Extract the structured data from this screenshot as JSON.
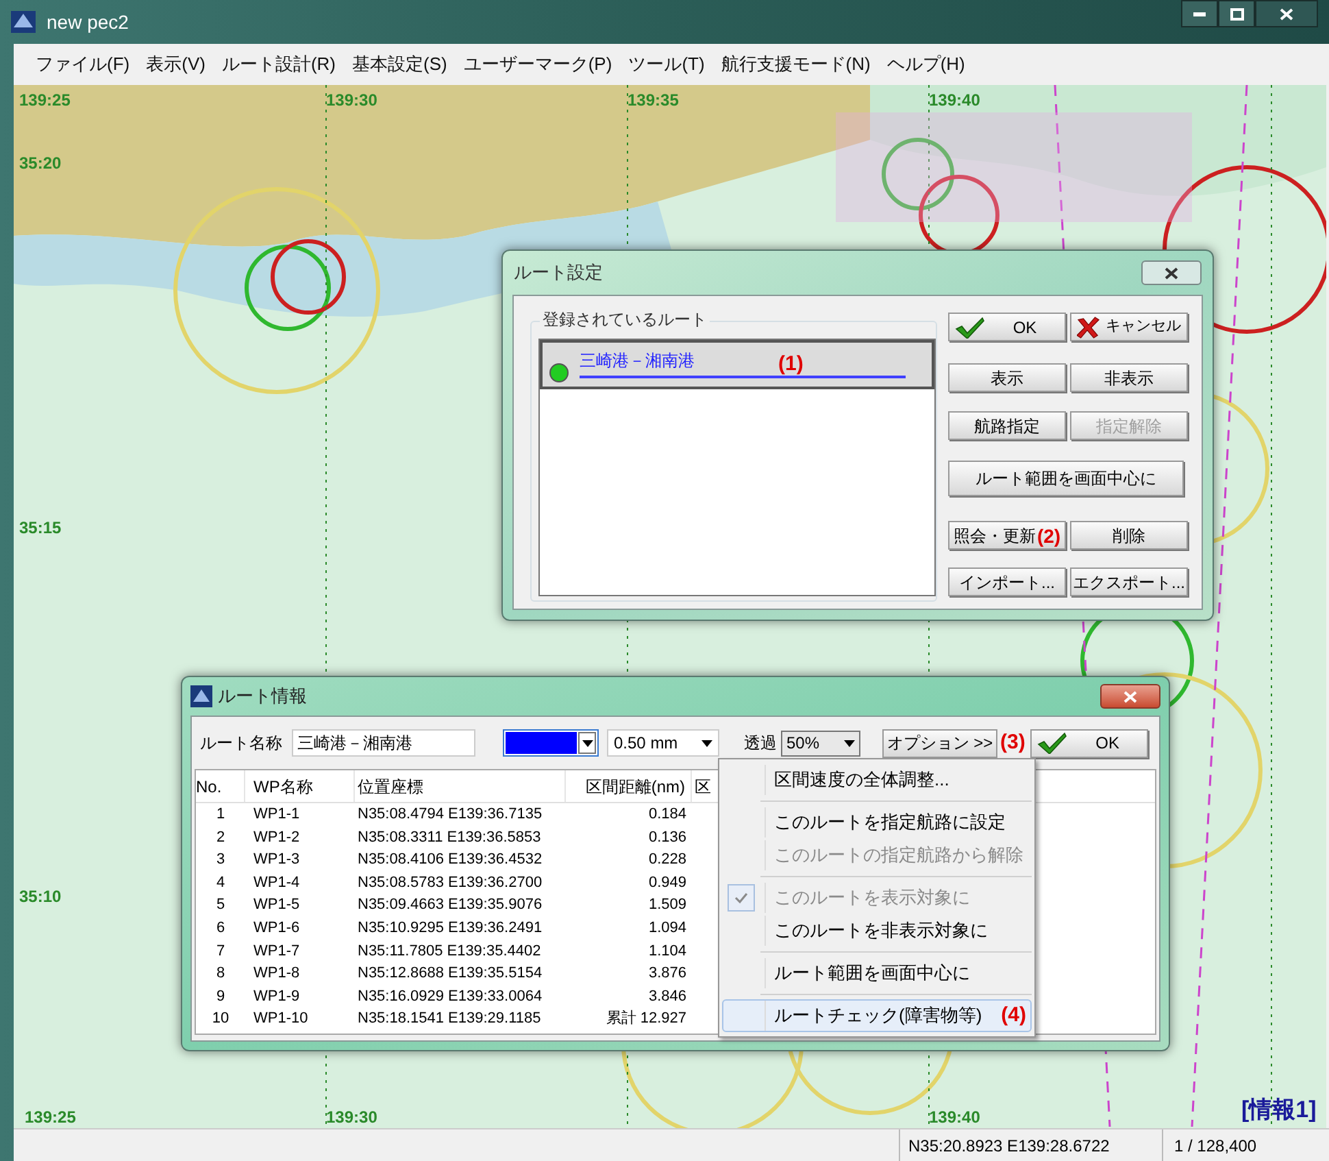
{
  "window": {
    "title": "new pec2"
  },
  "menu": [
    "ファイル(F)",
    "表示(V)",
    "ルート設計(R)",
    "基本設定(S)",
    "ユーザーマーク(P)",
    "ツール(T)",
    "航行支援モード(N)",
    "ヘルプ(H)"
  ],
  "map": {
    "kind": "picture",
    "top_labels": [
      "139:25",
      "139:30",
      "139:35",
      "139:40"
    ],
    "left_labels": [
      "35:20",
      "35:15",
      "35:10"
    ],
    "bottom_labels": [
      "139:25",
      "139:30",
      "139:40"
    ],
    "info_label": "[情報1]"
  },
  "route_settings": {
    "title": "ルート設定",
    "group_label": "登録されているルート",
    "annotation_1": "(1)",
    "annotation_2": "(2)",
    "routes": [
      {
        "name": "三崎港－湘南港",
        "selected": true,
        "color": "#22cc22"
      }
    ],
    "buttons": [
      {
        "label": "OK",
        "kind": "ok",
        "disabled": false
      },
      {
        "label": "キャンセル",
        "kind": "cancel",
        "disabled": false
      },
      {
        "label": "表示",
        "kind": "plain",
        "disabled": false
      },
      {
        "label": "非表示",
        "kind": "plain",
        "disabled": false
      },
      {
        "label": "航路指定",
        "kind": "plain",
        "disabled": false
      },
      {
        "label": "指定解除",
        "kind": "plain",
        "disabled": true
      },
      {
        "label": "ルート範囲を画面中心に",
        "kind": "wide",
        "disabled": false
      },
      {
        "label": "照会・更新",
        "kind": "plain",
        "disabled": false
      },
      {
        "label": "削除",
        "kind": "plain",
        "disabled": false
      },
      {
        "label": "インポート...",
        "kind": "plain",
        "disabled": false
      },
      {
        "label": "エクスポート...",
        "kind": "plain",
        "disabled": false
      }
    ]
  },
  "route_info": {
    "title": "ルート情報",
    "name_label": "ルート名称",
    "name_value": "三崎港－湘南港",
    "line_width": "0.50 mm",
    "transparency_label": "透過",
    "transparency": "50%",
    "options_button": "オプション >>",
    "annotation_3": "(3)",
    "ok_button": "OK",
    "columns": [
      "No.",
      "WP名称",
      "位置座標",
      "区間距離(nm)",
      "区"
    ],
    "rows": [
      [
        "1",
        "WP1-1",
        "N35:08.4794 E139:36.7135",
        "0.184"
      ],
      [
        "2",
        "WP1-2",
        "N35:08.3311 E139:36.5853",
        "0.136"
      ],
      [
        "3",
        "WP1-3",
        "N35:08.4106 E139:36.4532",
        "0.228"
      ],
      [
        "4",
        "WP1-4",
        "N35:08.5783 E139:36.2700",
        "0.949"
      ],
      [
        "5",
        "WP1-5",
        "N35:09.4663 E139:35.9076",
        "1.509"
      ],
      [
        "6",
        "WP1-6",
        "N35:10.9295 E139:36.2491",
        "1.094"
      ],
      [
        "7",
        "WP1-7",
        "N35:11.7805 E139:35.4402",
        "1.104"
      ],
      [
        "8",
        "WP1-8",
        "N35:12.8688 E139:35.5154",
        "3.876"
      ],
      [
        "9",
        "WP1-9",
        "N35:16.0929 E139:33.0064",
        "3.846"
      ],
      [
        "10",
        "WP1-10",
        "N35:18.1541 E139:29.1185",
        "累計 12.927"
      ]
    ]
  },
  "context_menu": {
    "annotation_4": "(4)",
    "items": [
      {
        "kind": "item",
        "label": "区間速度の全体調整...",
        "disabled": false,
        "checked": false,
        "selected": false
      },
      {
        "kind": "separator"
      },
      {
        "kind": "item",
        "label": "このルートを指定航路に設定",
        "disabled": false,
        "checked": false,
        "selected": false
      },
      {
        "kind": "item",
        "label": "このルートの指定航路から解除",
        "disabled": true,
        "checked": false,
        "selected": false
      },
      {
        "kind": "separator"
      },
      {
        "kind": "item",
        "label": "このルートを表示対象に",
        "disabled": true,
        "checked": true,
        "selected": false
      },
      {
        "kind": "item",
        "label": "このルートを非表示対象に",
        "disabled": false,
        "checked": false,
        "selected": false
      },
      {
        "kind": "separator"
      },
      {
        "kind": "item",
        "label": "ルート範囲を画面中心に",
        "disabled": false,
        "checked": false,
        "selected": false
      },
      {
        "kind": "separator"
      },
      {
        "kind": "item",
        "label": "ルートチェック(障害物等)",
        "disabled": false,
        "checked": false,
        "selected": true
      }
    ]
  },
  "status_bar": {
    "position": "N35:20.8923 E139:28.6722",
    "scale": "1 / 128,400"
  }
}
